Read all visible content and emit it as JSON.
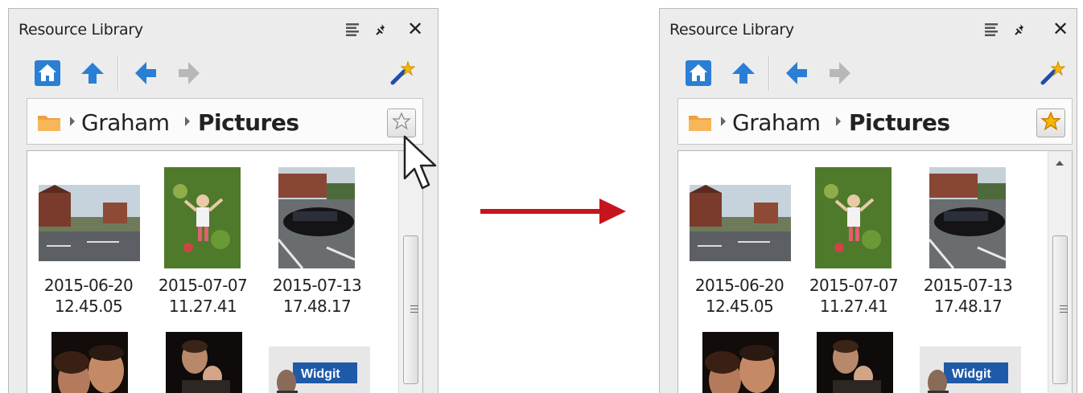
{
  "before": {
    "title": "Resource Library",
    "breadcrumb": {
      "parent": "Graham",
      "current": "Pictures"
    },
    "favorite_state": "not starred",
    "scroll_position": 0.3
  },
  "after": {
    "title": "Resource Library",
    "breadcrumb": {
      "parent": "Graham",
      "current": "Pictures"
    },
    "favorite_state": "starred",
    "scroll_position": 0.3
  },
  "files": [
    {
      "line1": "2015-06-20",
      "line2": "12.45.05",
      "thumb": "house-street-photo"
    },
    {
      "line1": "2015-07-07",
      "line2": "11.27.41",
      "thumb": "child-in-grass-photo"
    },
    {
      "line1": "2015-07-13",
      "line2": "17.48.17",
      "thumb": "car-parking-photo"
    },
    {
      "line1": "",
      "line2": "",
      "thumb": "couple-selfie-photo"
    },
    {
      "line1": "",
      "line2": "",
      "thumb": "father-child-photo"
    },
    {
      "line1": "",
      "line2": "",
      "thumb": "widgit-poster-photo"
    }
  ],
  "poster_text": "Widgit",
  "colors": {
    "nav_blue": "#2a7fd4",
    "transition_arrow": "#c4161c",
    "star_active": "#f5b800",
    "folder": "#f0a040"
  },
  "icons": {
    "menu": "list-icon",
    "pin": "pin-icon",
    "close": "close-icon",
    "home": "home-icon",
    "up": "up-arrow-icon",
    "back": "back-arrow-icon",
    "forward": "forward-arrow-icon",
    "magic": "magic-wand-icon",
    "folder": "folder-icon",
    "favorite": "star-icon"
  }
}
